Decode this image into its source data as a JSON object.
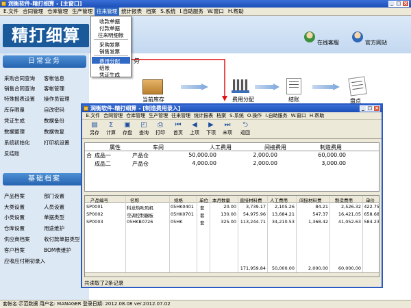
{
  "main_window": {
    "title": "润衡软件-精打细算 - [主窗口]",
    "menu": [
      "E.文件",
      "合同管理",
      "仓库管理",
      "生产管理",
      "往来管理",
      "统计报表",
      "档案",
      "S.系统",
      "I.自助服务",
      "W.窗口",
      "H.帮助"
    ],
    "active_menu_index": 4
  },
  "logo_text": "精打细算",
  "top_links": [
    {
      "label": "在线客服",
      "icon": "customer-service-icon"
    },
    {
      "label": "官方网站",
      "icon": "official-site-icon"
    }
  ],
  "daily_section": {
    "title": "日常业务",
    "items": [
      [
        "采购合同查询",
        "客帐信息"
      ],
      [
        "销售合同查询",
        "客帐管理"
      ],
      [
        "特殊报表设置",
        "操作员管理"
      ],
      [
        "库存限量",
        "自改密码"
      ],
      [
        "凭证生成",
        "数据备份"
      ],
      [
        "数据整理",
        "数据恢复"
      ],
      [
        "系统初始化",
        "打印机设置"
      ],
      [
        "反结账",
        ""
      ]
    ]
  },
  "basic_section": {
    "title": "基础档案",
    "items": [
      [
        "产品档案",
        "部门设置"
      ],
      [
        "大类设置",
        "人员设置"
      ],
      [
        "小类设置",
        "单据类型"
      ],
      [
        "仓库设置",
        "用途维护"
      ],
      [
        "供应商档案",
        "收付款单据类型"
      ],
      [
        "客户档案",
        "BOM表维护"
      ],
      [
        "应收应付期初录入",
        ""
      ]
    ]
  },
  "dropdown_menu": {
    "group1": [
      "收款单据",
      "付款单据",
      "往来明细帐"
    ],
    "group2": [
      "采购发票",
      "销售发票"
    ],
    "group3": [
      "费用分配",
      "结账",
      "凭证生成"
    ],
    "highlighted": "费用分配"
  },
  "workflow": [
    {
      "label": "当前库存",
      "icon": "inventory-box-icon"
    },
    {
      "label": "费用分配",
      "icon": "cost-allocation-icon"
    },
    {
      "label": "结账",
      "icon": "checkout-icon"
    },
    {
      "label": "盘点",
      "icon": "stocktake-icon"
    }
  ],
  "partial_heading": "务",
  "child_window": {
    "title": "润衡软件-精打细算 - [制造费用录入]",
    "menu": [
      "E.文件",
      "合同管理",
      "仓库管理",
      "生产管理",
      "往来管理",
      "统计报表",
      "档案",
      "S.系统",
      "O.操作",
      "I.自助服务",
      "W.窗口",
      "H.帮助"
    ],
    "toolbar": [
      {
        "label": "另存",
        "icon": "save-as-icon"
      },
      {
        "label": "计算",
        "icon": "calculate-icon"
      },
      {
        "label": "存盘",
        "icon": "save-icon"
      },
      {
        "label": "查询",
        "icon": "query-icon"
      },
      {
        "label": "打印",
        "icon": "print-icon"
      },
      {
        "label": "首页",
        "icon": "first-page-icon"
      },
      {
        "label": "上项",
        "icon": "previous-icon"
      },
      {
        "label": "下项",
        "icon": "next-icon"
      },
      {
        "label": "末项",
        "icon": "last-page-icon"
      },
      {
        "label": "返回",
        "icon": "return-icon"
      }
    ],
    "cost_grid": {
      "headers": [
        "属性",
        "车间",
        "人工费用",
        "间接费用",
        "制造费用"
      ],
      "rows": [
        {
          "attr": "成品一",
          "workshop": "产品仓",
          "labor": "50,000.00",
          "indirect": "2,000.00",
          "manufacturing": "60,000.00"
        },
        {
          "attr": "成品二",
          "workshop": "产品仓",
          "labor": "4,000.00",
          "indirect": "2,000.00",
          "manufacturing": "3,000.00"
        }
      ]
    },
    "product_grid": {
      "headers": [
        "产品编号",
        "名称",
        "规格",
        "单位",
        "本月数量",
        "直接材料费",
        "人工费用",
        "间接材料费",
        "制造费用",
        "单价"
      ],
      "rows": [
        [
          "SP0001",
          "科龙热吹风机",
          "05HK0401",
          "套",
          "20.00",
          "3,739.17",
          "2,105.26",
          "84.21",
          "2,526.32",
          "422.75"
        ],
        [
          "SP0002",
          "空调控制器板",
          "05HK0701",
          "套",
          "130.00",
          "54,975.96",
          "13,684.21",
          "547.37",
          "16,421.05",
          "658.68"
        ],
        [
          "SP0003",
          "05HKB0726",
          "05HK",
          "套",
          "325.00",
          "113,244.71",
          "34,210.53",
          "1,368.42",
          "41,052.63",
          "584.23"
        ]
      ],
      "totals": [
        "171,959.84",
        "50,000.00",
        "2,000.00",
        "60,000.00"
      ]
    },
    "status_text": "共读取了2条记录"
  },
  "status_bar": "套帐名:示范数据    用户名: MANAGER    登录日期: 2012.08.08    ver.2012.07.02"
}
